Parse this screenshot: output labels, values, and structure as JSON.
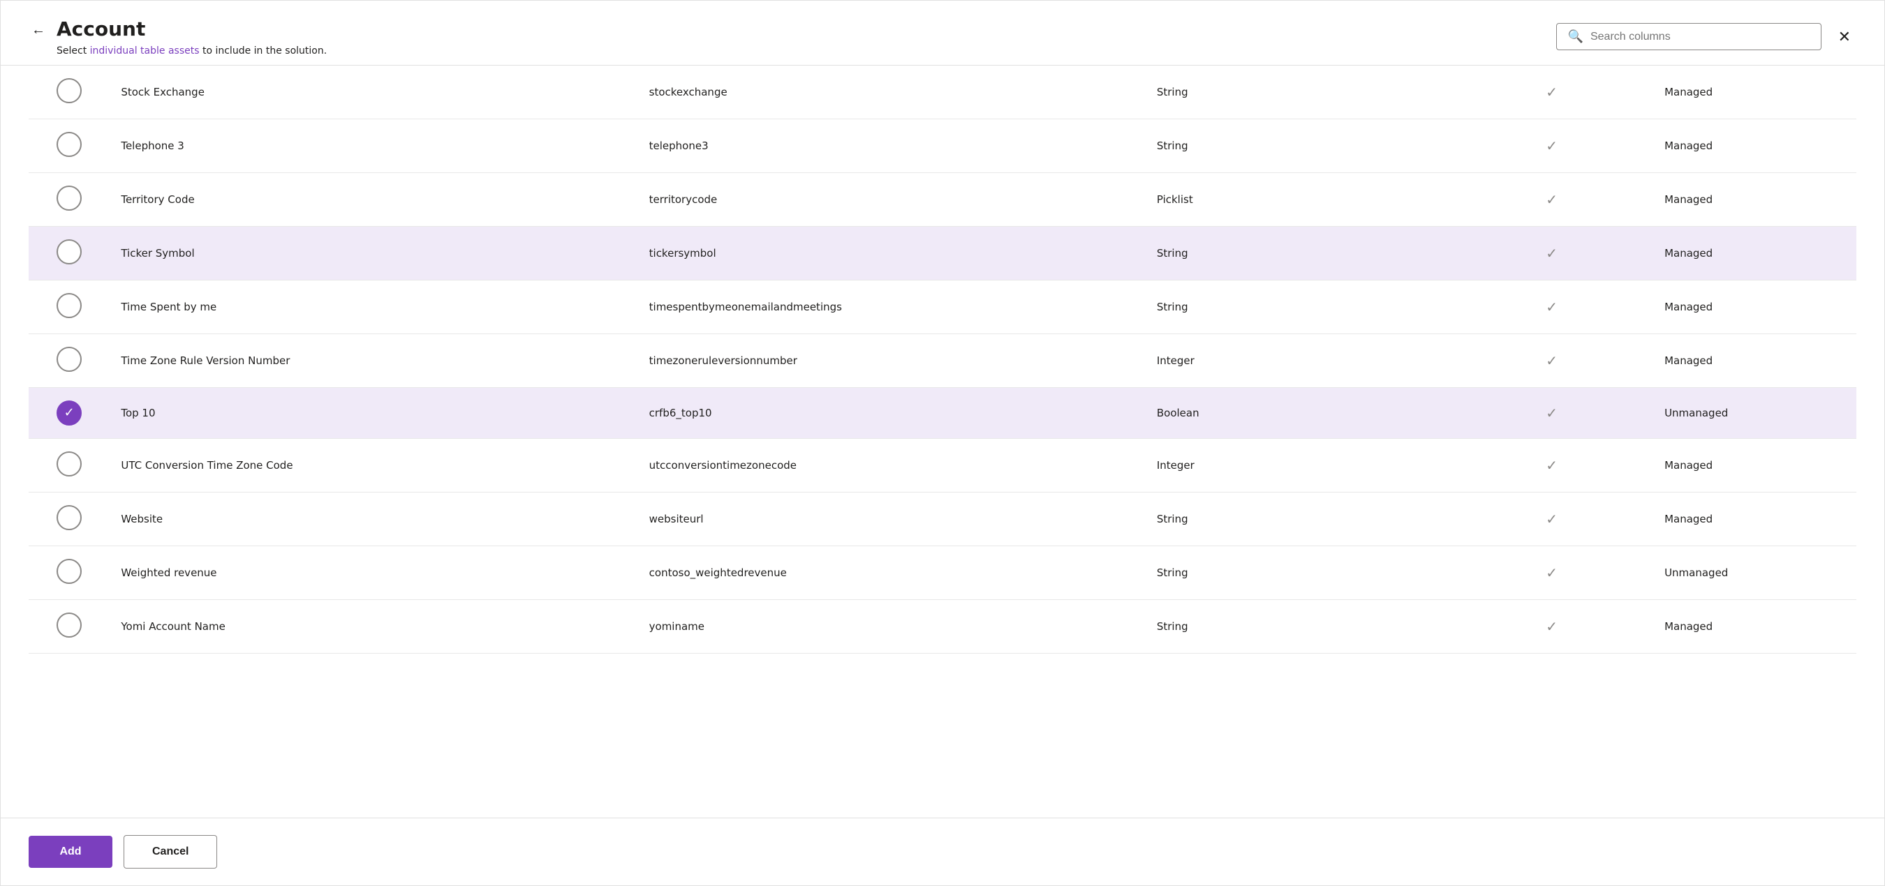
{
  "dialog": {
    "title": "Account",
    "subtitle_static": "Select ",
    "subtitle_highlight": "individual table assets",
    "subtitle_rest": " to include in the solution.",
    "search_placeholder": "Search columns"
  },
  "buttons": {
    "back_label": "←",
    "close_label": "✕",
    "add_label": "Add",
    "cancel_label": "Cancel"
  },
  "columns": [
    {
      "name": "Stock Exchange",
      "logical": "stockexchange",
      "type": "String",
      "managed": "Managed",
      "selected": false
    },
    {
      "name": "Telephone 3",
      "logical": "telephone3",
      "type": "String",
      "managed": "Managed",
      "selected": false
    },
    {
      "name": "Territory Code",
      "logical": "territorycode",
      "type": "Picklist",
      "managed": "Managed",
      "selected": false
    },
    {
      "name": "Ticker Symbol",
      "logical": "tickersymbol",
      "type": "String",
      "managed": "Managed",
      "selected": false,
      "hovered": true
    },
    {
      "name": "Time Spent by me",
      "logical": "timespentbymeonemailandmeetings",
      "type": "String",
      "managed": "Managed",
      "selected": false
    },
    {
      "name": "Time Zone Rule Version Number",
      "logical": "timezoneruleversionnumber",
      "type": "Integer",
      "managed": "Managed",
      "selected": false
    },
    {
      "name": "Top 10",
      "logical": "crfb6_top10",
      "type": "Boolean",
      "managed": "Unmanaged",
      "selected": true
    },
    {
      "name": "UTC Conversion Time Zone Code",
      "logical": "utcconversiontimezonecode",
      "type": "Integer",
      "managed": "Managed",
      "selected": false
    },
    {
      "name": "Website",
      "logical": "websiteurl",
      "type": "String",
      "managed": "Managed",
      "selected": false
    },
    {
      "name": "Weighted revenue",
      "logical": "contoso_weightedrevenue",
      "type": "String",
      "managed": "Unmanaged",
      "selected": false
    },
    {
      "name": "Yomi Account Name",
      "logical": "yominame",
      "type": "String",
      "managed": "Managed",
      "selected": false
    }
  ]
}
